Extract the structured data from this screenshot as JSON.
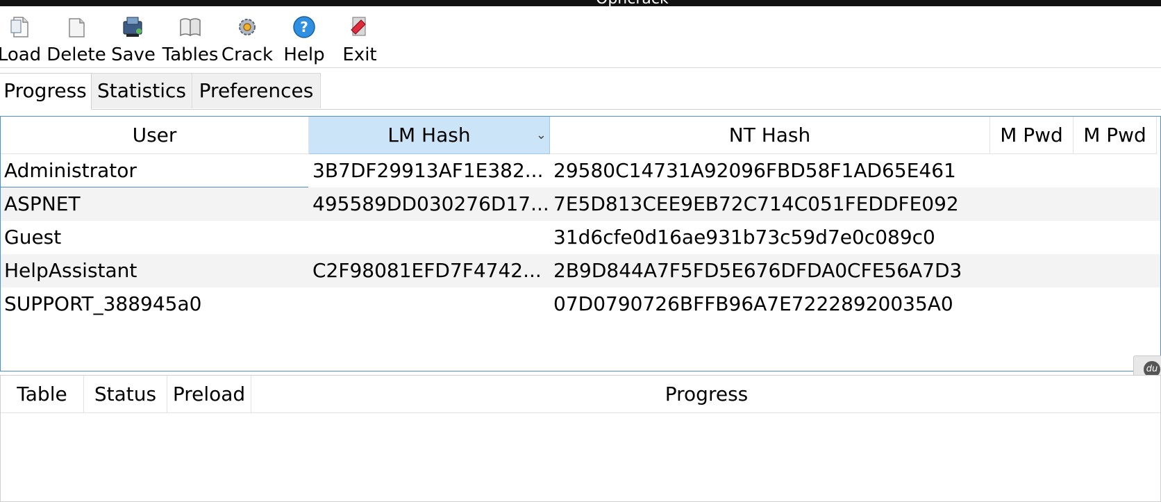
{
  "window": {
    "title": "Ophcrack"
  },
  "toolbar": {
    "items": [
      {
        "label": "Load",
        "icon": "load-icon"
      },
      {
        "label": "Delete",
        "icon": "delete-icon"
      },
      {
        "label": "Save",
        "icon": "save-icon"
      },
      {
        "label": "Tables",
        "icon": "tables-icon"
      },
      {
        "label": "Crack",
        "icon": "crack-icon"
      },
      {
        "label": "Help",
        "icon": "help-icon"
      },
      {
        "label": "Exit",
        "icon": "exit-icon"
      }
    ]
  },
  "tabs": [
    {
      "label": "Progress",
      "active": true
    },
    {
      "label": "Statistics",
      "active": false
    },
    {
      "label": "Preferences",
      "active": false
    }
  ],
  "users_table": {
    "columns": [
      "User",
      "LM Hash",
      "NT Hash",
      "M Pwd",
      "M Pwd"
    ],
    "rows": [
      {
        "user": "Administrator",
        "lm": "3B7DF29913AF1E382...",
        "nt": "29580C14731A92096FBD58F1AD65E461"
      },
      {
        "user": "ASPNET",
        "lm": "495589DD030276D17...",
        "nt": "7E5D813CEE9EB72C714C051FEDDFE092"
      },
      {
        "user": "Guest",
        "lm": "",
        "nt": "31d6cfe0d16ae931b73c59d7e0c089c0"
      },
      {
        "user": "HelpAssistant",
        "lm": "C2F98081EFD7F4742...",
        "nt": "2B9D844A7F5FD5E676DFDA0CFE56A7D3"
      },
      {
        "user": "SUPPORT_388945a0",
        "lm": "",
        "nt": "07D0790726BFFB96A7E72228920035A0"
      }
    ]
  },
  "tables_table": {
    "columns": [
      "Table",
      "Status",
      "Preload",
      "Progress"
    ]
  },
  "colors": {
    "accent": "#4a90d9",
    "sorted_header": "#cce4f7",
    "alt_row": "#f3f3f3"
  }
}
